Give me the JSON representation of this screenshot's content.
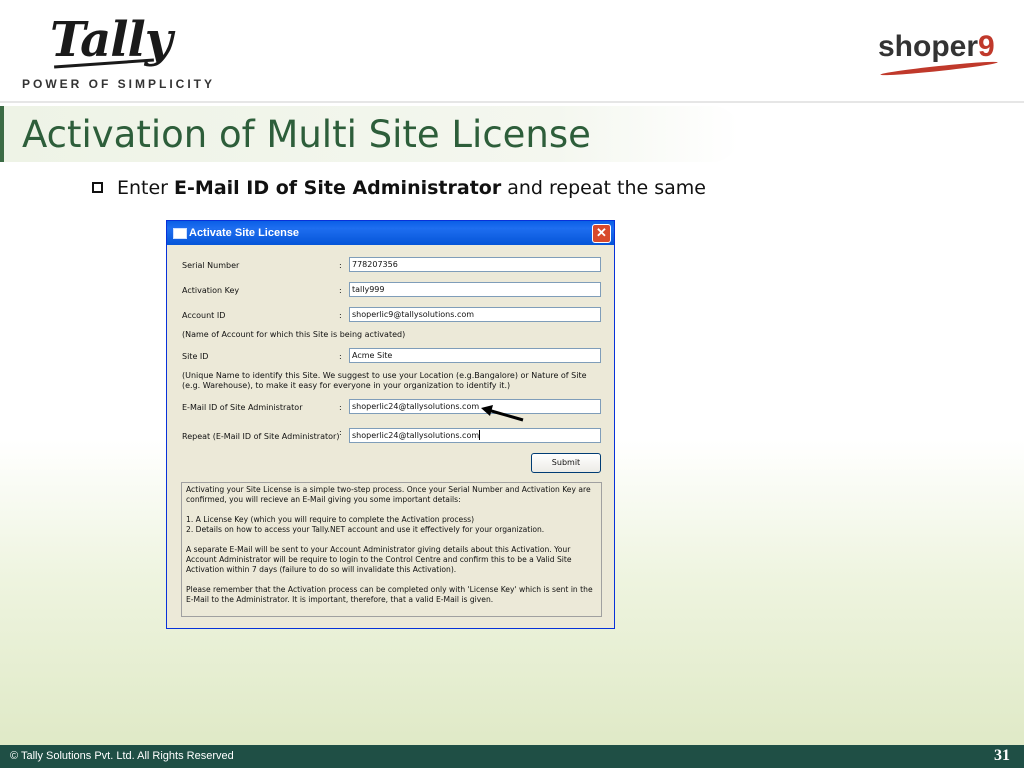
{
  "header": {
    "logo_text": "Tally",
    "tagline": "POWER OF SIMPLICITY",
    "right_logo_text": "shoper",
    "right_logo_num": "9"
  },
  "slide": {
    "title": "Activation of Multi Site License",
    "bullet_prefix": "Enter ",
    "bullet_bold": "E-Mail ID of Site Administrator",
    "bullet_suffix": " and repeat the same"
  },
  "dialog": {
    "title": "Activate Site License",
    "close_label": "✕",
    "fields": {
      "serial_label": "Serial Number",
      "serial_value": "778207356",
      "activation_label": "Activation Key",
      "activation_value": "tally999",
      "account_label": "Account ID",
      "account_value": "shoperlic9@tallysolutions.com",
      "account_note": "(Name of Account for which this Site is being activated)",
      "site_label": "Site ID",
      "site_value": "Acme Site",
      "site_note": "(Unique Name to identify this Site. We suggest to use your Location (e.g.Bangalore) or Nature of Site (e.g. Warehouse), to make it easy for everyone in your organization to identify it.)",
      "email_label": "E-Mail ID of Site Administrator",
      "email_value": "shoperlic24@tallysolutions.com",
      "repeat_label": "Repeat (E-Mail ID of Site Administrator)",
      "repeat_value": "shoperlic24@tallysolutions.com",
      "colon": ":"
    },
    "submit_label": "Submit",
    "info": {
      "p1": "Activating your Site License is a simple two-step process. Once your Serial Number and Activation Key are confirmed, you will recieve an E-Mail giving you some important details:",
      "p2a": "1.  A License Key (which you will require to complete the Activation process)",
      "p2b": "2.  Details on how to access your Tally.NET account and use it effectively for your organization.",
      "p3": "A separate E-Mail will be sent to your Account Administrator giving details about this Activation. Your Account Administrator will be require to login to the Control Centre and confirm this to be a Valid Site Activation within 7 days (failure to do so will invalidate this Activation).",
      "p4": "Please remember that the Activation process can be completed only with 'License Key' which is sent in the E-Mail to the Administrator. It is important, therefore, that a valid E-Mail is given."
    }
  },
  "footer": {
    "copyright": "© Tally Solutions Pvt. Ltd. All Rights Reserved",
    "page_number": "31"
  },
  "colors": {
    "title_green": "#2d5e3a",
    "footer_bg": "#1f4f45",
    "xp_title_blue": "#0a5fe6",
    "shoper_red": "#c0392b"
  }
}
